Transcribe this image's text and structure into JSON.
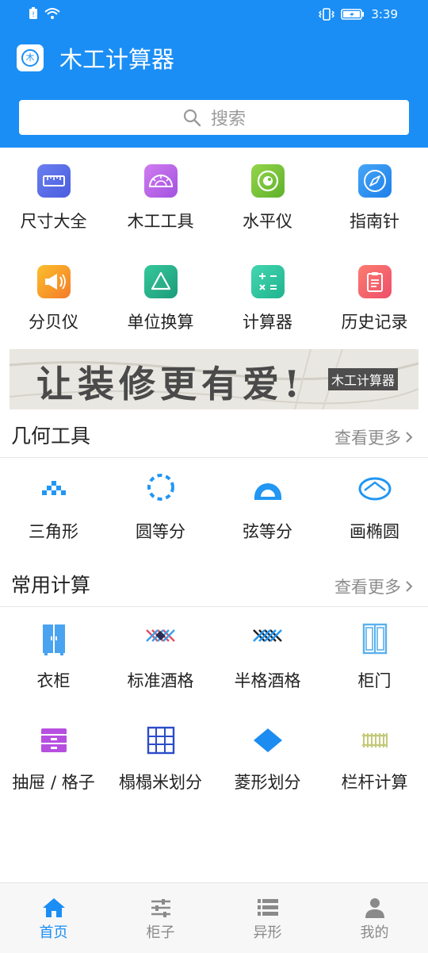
{
  "status_bar": {
    "time": "3:39"
  },
  "app": {
    "title": "木工计算器",
    "logo_char": "木"
  },
  "search": {
    "placeholder": "搜索"
  },
  "tools": [
    {
      "label": "尺寸大全",
      "icon": "ruler-icon",
      "color": "#5b6fe8"
    },
    {
      "label": "木工工具",
      "icon": "protractor-icon",
      "color": "#b860e6"
    },
    {
      "label": "水平仪",
      "icon": "level-icon",
      "color": "#7dc53a"
    },
    {
      "label": "指南针",
      "icon": "compass-icon",
      "color": "#2a8ff2"
    },
    {
      "label": "分贝仪",
      "icon": "megaphone-icon",
      "color": "#f5a123"
    },
    {
      "label": "单位换算",
      "icon": "unit-convert-icon",
      "color": "#22b38c"
    },
    {
      "label": "计算器",
      "icon": "calculator-icon",
      "color": "#2fc7a0"
    },
    {
      "label": "历史记录",
      "icon": "history-clipboard-icon",
      "color": "#f35f5f"
    }
  ],
  "banner": {
    "slogan": "让装修更有爱!",
    "badge": "木工计算器"
  },
  "geometry": {
    "title": "几何工具",
    "more": "查看更多",
    "items": [
      {
        "label": "三角形",
        "icon": "triangle-icon"
      },
      {
        "label": "圆等分",
        "icon": "circle-divide-icon"
      },
      {
        "label": "弦等分",
        "icon": "chord-divide-icon"
      },
      {
        "label": "画椭圆",
        "icon": "ellipse-icon"
      }
    ]
  },
  "common": {
    "title": "常用计算",
    "more": "查看更多",
    "items": [
      {
        "label": "衣柜",
        "icon": "wardrobe-icon"
      },
      {
        "label": "标准酒格",
        "icon": "wine-rack-icon"
      },
      {
        "label": "半格酒格",
        "icon": "half-wine-rack-icon"
      },
      {
        "label": "柜门",
        "icon": "cabinet-door-icon"
      },
      {
        "label": "抽屉 / 格子",
        "icon": "drawer-icon"
      },
      {
        "label": "榻榻米划分",
        "icon": "tatami-icon"
      },
      {
        "label": "菱形划分",
        "icon": "diamond-icon"
      },
      {
        "label": "栏杆计算",
        "icon": "railing-icon"
      }
    ]
  },
  "tabbar": [
    {
      "label": "首页",
      "icon": "home-icon",
      "active": true
    },
    {
      "label": "柜子",
      "icon": "sliders-icon",
      "active": false
    },
    {
      "label": "异形",
      "icon": "list-icon",
      "active": false
    },
    {
      "label": "我的",
      "icon": "user-icon",
      "active": false
    }
  ],
  "colors": {
    "primary": "#1a8ef5",
    "geometry_icon": "#2196f3"
  }
}
